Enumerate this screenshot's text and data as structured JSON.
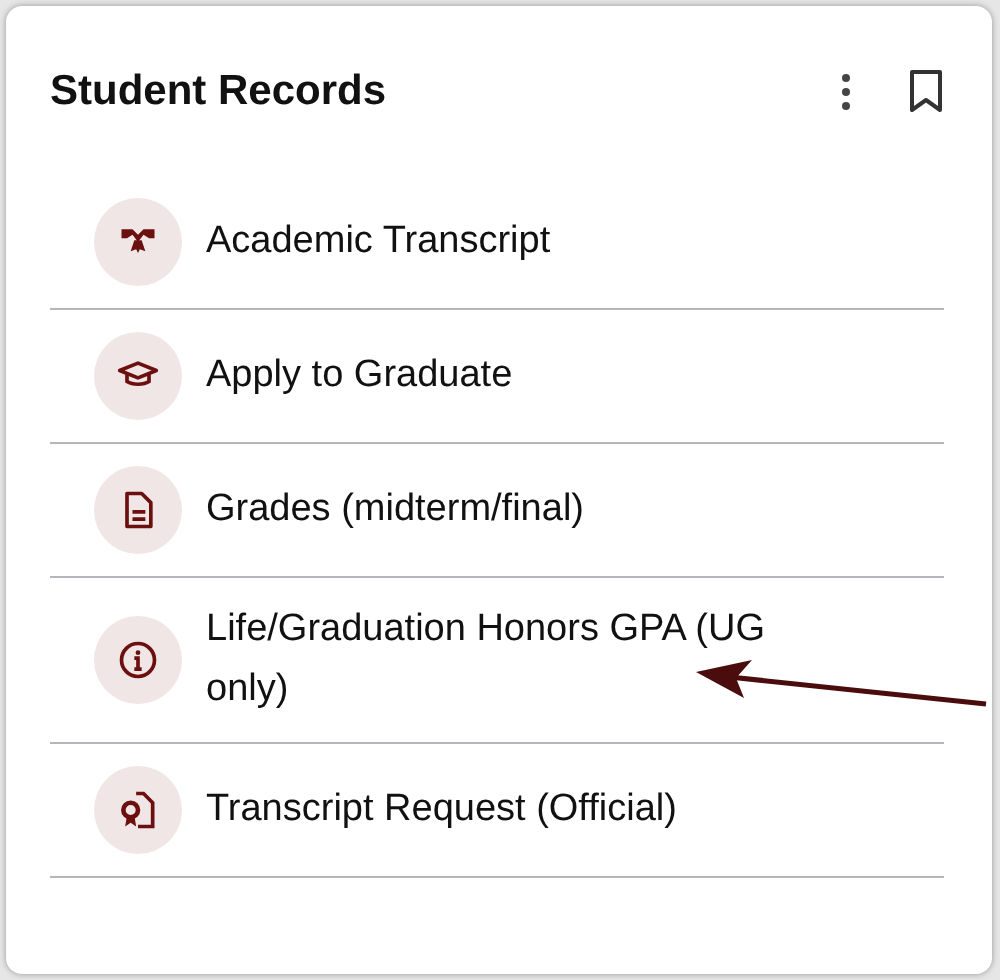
{
  "card": {
    "title": "Student Records"
  },
  "items": [
    {
      "label": "Academic Transcript",
      "kind": "diploma"
    },
    {
      "label": "Apply to Graduate",
      "kind": "cap"
    },
    {
      "label": "Grades (midterm/final)",
      "kind": "document"
    },
    {
      "label": "Life/Graduation Honors GPA (UG only)",
      "kind": "info"
    },
    {
      "label": "Transcript Request (Official)",
      "kind": "certificate"
    }
  ]
}
